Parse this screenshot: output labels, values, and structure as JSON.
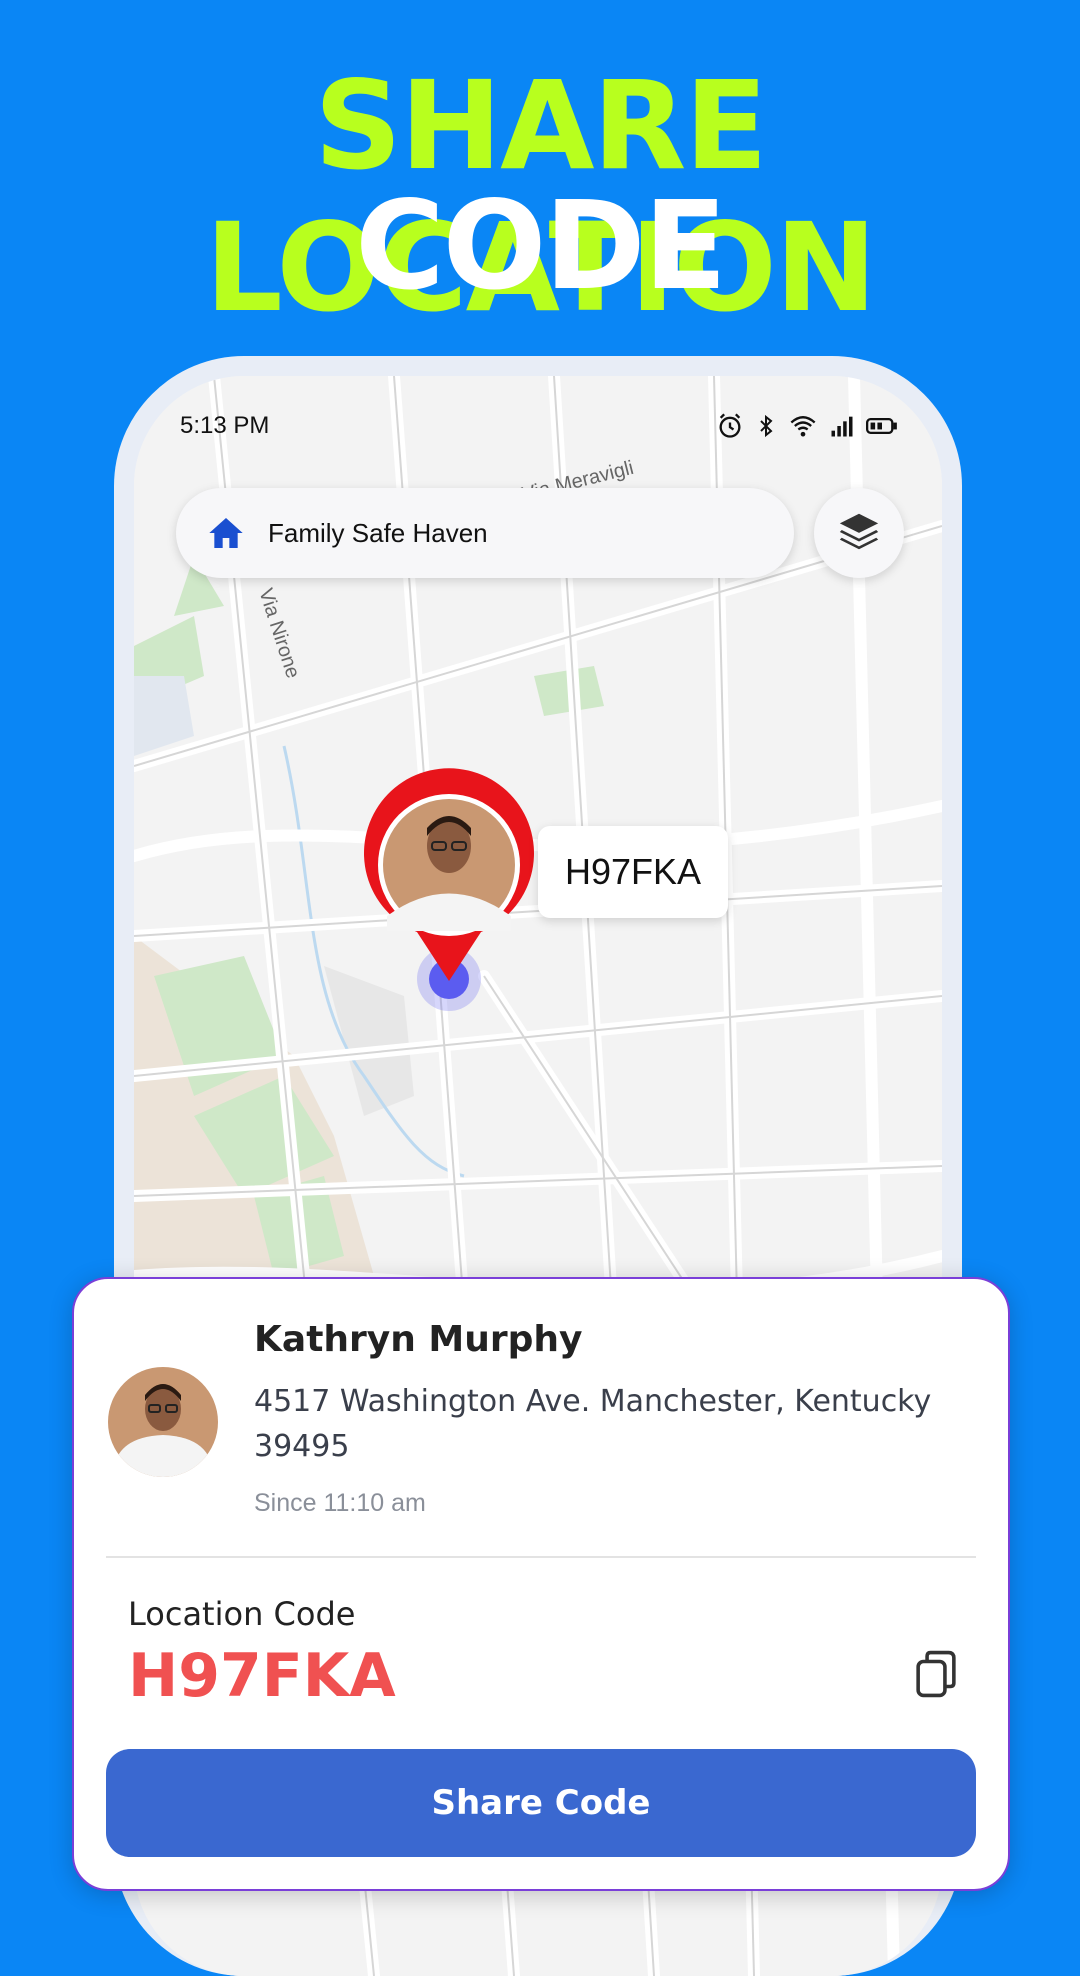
{
  "headline": {
    "line1": "SHARE LOCATION",
    "line2": "CODE"
  },
  "status_bar": {
    "time": "5:13 PM",
    "icons": [
      "alarm-icon",
      "bluetooth-icon",
      "wifi-icon",
      "signal-icon",
      "battery-icon"
    ]
  },
  "search": {
    "title": "Family Safe Haven",
    "icon": "home-icon"
  },
  "map": {
    "street_labels": [
      "Via Meravigli",
      "Via Nirone"
    ],
    "pin_code": "H97FKA",
    "pin_color": "#e8141b",
    "location_dot_color": "#5b5cf0"
  },
  "card": {
    "name": "Kathryn Murphy",
    "address": "4517 Washington Ave. Manchester, Kentucky 39495",
    "since": "Since 11:10 am",
    "code_label": "Location Code",
    "code_value": "H97FKA",
    "share_label": "Share Code"
  },
  "colors": {
    "background": "#0a86f5",
    "headline_accent": "#b8ff1e",
    "code_red": "#f05151",
    "button_blue": "#3a68d0"
  }
}
